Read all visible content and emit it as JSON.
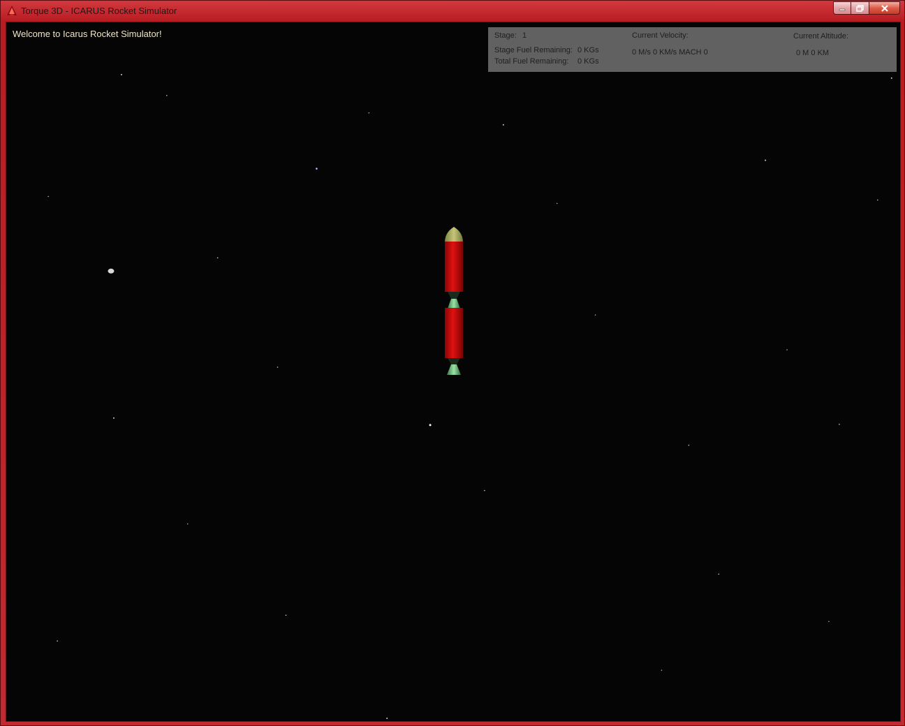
{
  "window": {
    "title": "Torque 3D - ICARUS Rocket Simulator",
    "icon": "torque-app-icon",
    "controls": [
      "minimize-icon",
      "maximize-icon",
      "close-icon"
    ]
  },
  "viewport": {
    "welcome_text": "Welcome to Icarus Rocket Simulator!"
  },
  "hud": {
    "stage_label": "Stage:",
    "stage_value": "1",
    "stage_fuel_label": "Stage Fuel Remaining:",
    "stage_fuel_value": "0 KGs",
    "total_fuel_label": "Total Fuel Remaining:",
    "total_fuel_value": "0 KGs",
    "velocity_label": "Current Velocity:",
    "velocity_value": "0 M/s 0 KM/s MACH 0",
    "altitude_label": "Current Altitude:",
    "altitude_value": "0 M 0 KM"
  },
  "colors": {
    "frame": "#c1272d",
    "space": "#050505",
    "rocket_body": "#d40e0e",
    "nozzle": "#7fcf8a",
    "hud_panel": "#808080"
  }
}
